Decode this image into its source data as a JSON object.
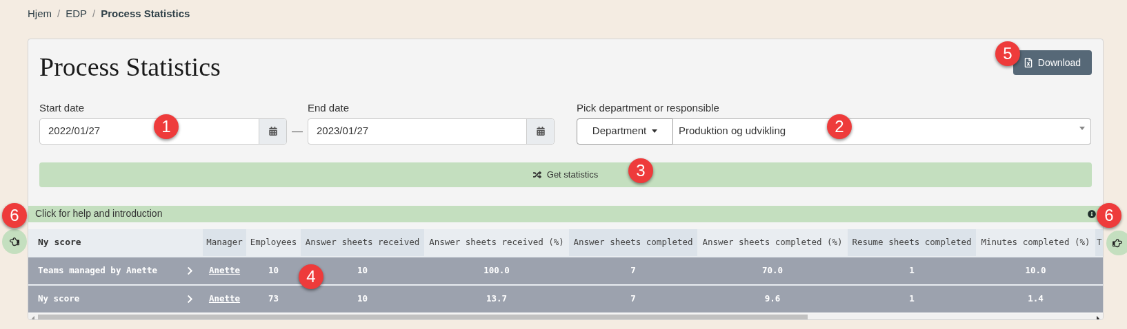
{
  "breadcrumb": [
    {
      "label": "Hjem",
      "current": false
    },
    {
      "label": "EDP",
      "current": false
    },
    {
      "label": "Process Statistics",
      "current": true
    }
  ],
  "breadcrumb_separator": "/",
  "title": "Process Statistics",
  "download_button": "Download",
  "start_date": {
    "label": "Start date",
    "value": "2022/01/27"
  },
  "range_separator": "—",
  "end_date": {
    "label": "End date",
    "value": "2023/01/27"
  },
  "department": {
    "label": "Pick department or responsible",
    "mode": "Department",
    "value": "Produktion og udvikling"
  },
  "get_statistics_button": "Get statistics",
  "help_bar": "Click for help and introduction",
  "table": {
    "columns": [
      {
        "label": "Ny score",
        "shaded": false
      },
      {
        "label": "Manager",
        "shaded": true
      },
      {
        "label": "Employees",
        "shaded": false
      },
      {
        "label": "Answer sheets received",
        "shaded": true
      },
      {
        "label": "Answer sheets received (%)",
        "shaded": false
      },
      {
        "label": "Answer sheets completed",
        "shaded": true
      },
      {
        "label": "Answer sheets completed (%)",
        "shaded": false
      },
      {
        "label": "Resume sheets completed",
        "shaded": true
      },
      {
        "label": "Minutes completed (%)",
        "shaded": false
      },
      {
        "label": "T",
        "shaded": true
      }
    ],
    "rows": [
      {
        "cells": [
          "Teams managed by Anette",
          "Anette",
          "10",
          "10",
          "100.0",
          "7",
          "70.0",
          "1",
          "10.0"
        ]
      },
      {
        "cells": [
          "Ny score",
          "Anette",
          "73",
          "10",
          "13.7",
          "7",
          "9.6",
          "1",
          "1.4"
        ]
      }
    ]
  },
  "markers": [
    "1",
    "2",
    "3",
    "4",
    "5",
    "6",
    "6"
  ]
}
